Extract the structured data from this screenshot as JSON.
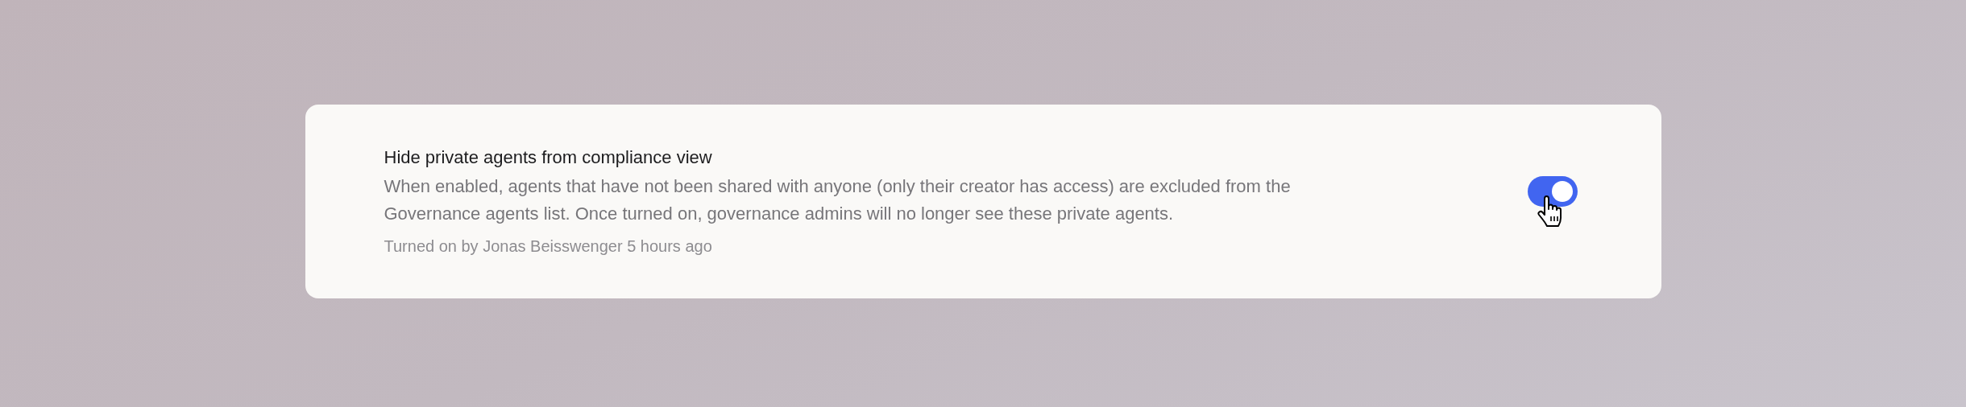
{
  "setting": {
    "title": "Hide private agents from compliance view",
    "description": "When enabled, agents that have not been shared with anyone (only their creator has access) are excluded from the Governance agents list. Once turned on, governance admins will no longer see these private agents.",
    "meta": "Turned on by Jonas Beisswenger 5 hours ago",
    "on": true
  }
}
